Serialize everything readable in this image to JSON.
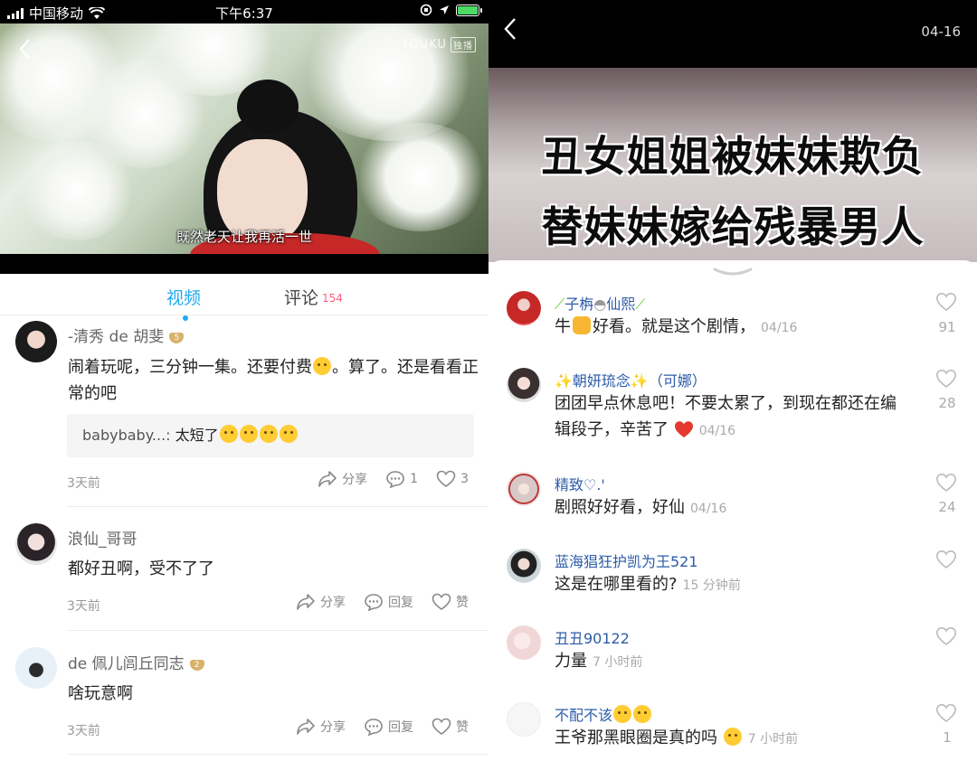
{
  "left": {
    "status": {
      "carrier": "中国移动",
      "time": "下午6:37"
    },
    "video": {
      "brand": "YOUKU",
      "exclusive": "独播",
      "subtitle": "既然老天让我再活一世"
    },
    "tabs": [
      {
        "label": "视频",
        "active": true
      },
      {
        "label": "评论",
        "count": "154"
      }
    ],
    "comments": [
      {
        "name": "-清秀 de 胡斐",
        "badge": "5",
        "text": "闹着玩呢，三分钟一集。还要付费",
        "text_tail": "。算了。还是看看正常的吧",
        "reply": {
          "name": "babybaby...:",
          "text": "太短了"
        },
        "time": "3天前",
        "share": "分享",
        "reply_count": "1",
        "likes": "3"
      },
      {
        "name": "浪仙_哥哥",
        "text": "都好丑啊，受不了了",
        "time": "3天前",
        "share": "分享",
        "reply_label": "回复",
        "like_label": "赞"
      },
      {
        "name": "de 佩儿闾丘同志",
        "badge": "2",
        "text": "啥玩意啊",
        "time": "3天前",
        "share": "分享",
        "reply_label": "回复",
        "like_label": "赞"
      }
    ]
  },
  "right": {
    "date": "04-16",
    "banner": {
      "line1": "丑女姐姐被妹妹欺负",
      "line2": "替妹妹嫁给残暴男人"
    },
    "comments": [
      {
        "name": "子栴",
        "name_tail": "仙熙",
        "text": "牛",
        "text_tail": "好看。就是这个剧情，",
        "time": "04/16",
        "likes": "91"
      },
      {
        "name": "✨朝妍琉念✨（可娜）",
        "text": "团团早点休息吧！不要太累了，到现在都还在编辑段子，辛苦了",
        "time": "04/16",
        "likes": "28"
      },
      {
        "name": "精致♡.'",
        "text": "剧照好好看，好仙",
        "time": "04/16",
        "likes": "24"
      },
      {
        "name": "蓝海猖狂护凯为王521",
        "text": "这是在哪里看的?",
        "time": "15 分钟前",
        "likes": ""
      },
      {
        "name": "丑丑90122",
        "text": "力量",
        "time": "7 小时前",
        "likes": ""
      },
      {
        "name": "不配不该",
        "text": "王爷那黑眼圈是真的吗",
        "time": "7 小时前",
        "likes": "1"
      }
    ]
  },
  "colors": {
    "accent": "#1eaaf1",
    "count_pink": "#ff5e7e",
    "username_blue": "#2d5ca8"
  }
}
